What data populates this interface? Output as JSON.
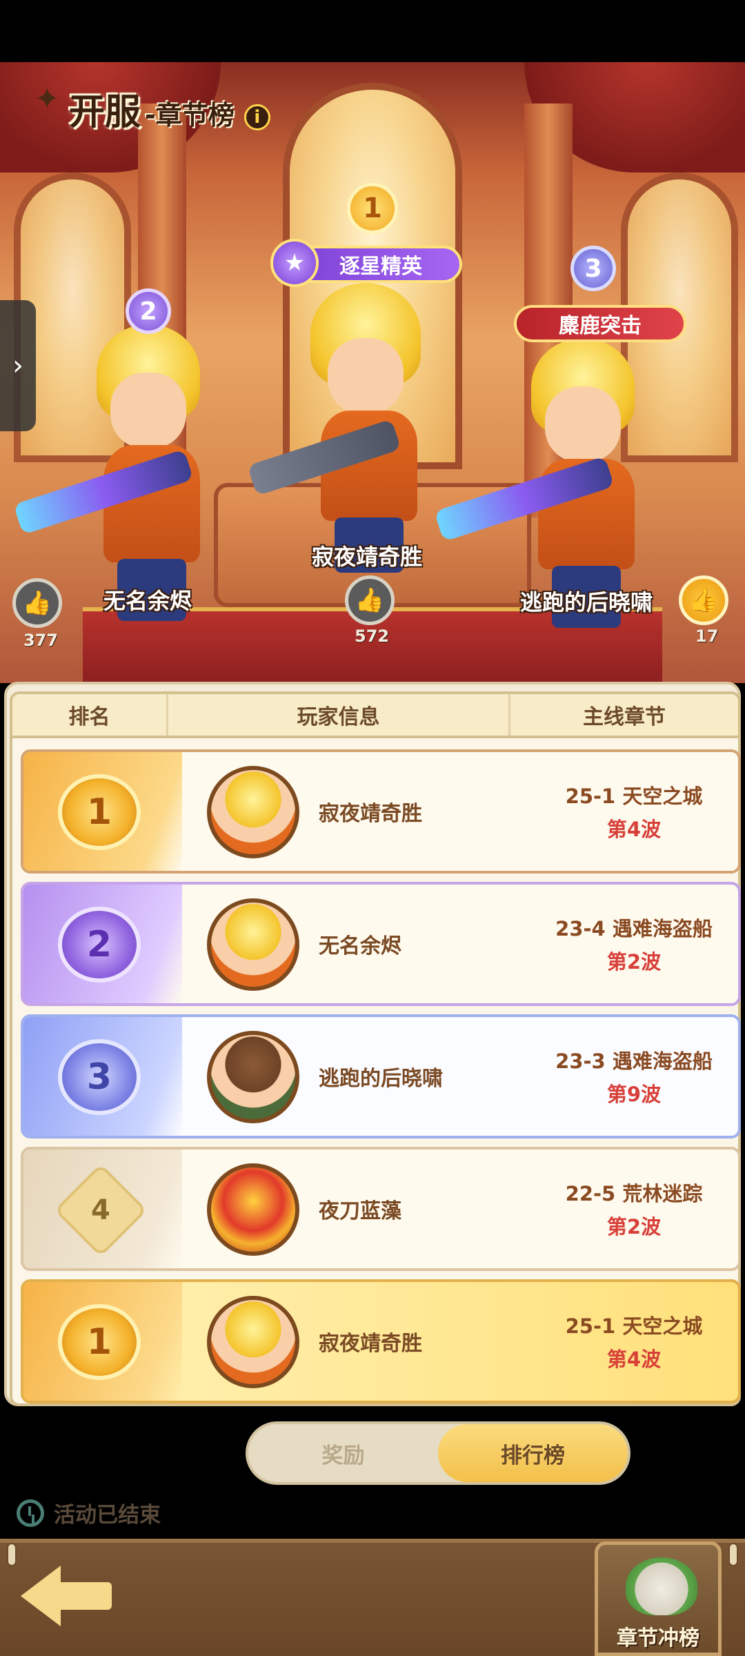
{
  "header": {
    "title_main": "开服",
    "title_sub": "-章节榜",
    "info_icon": "i"
  },
  "podium": {
    "first": {
      "rank": "1",
      "title_badge": "逐星精英",
      "name": "寂夜靖奇胜",
      "likes": "572"
    },
    "second": {
      "rank": "2",
      "name": "无名余烬",
      "likes": "377"
    },
    "third": {
      "rank": "3",
      "title_badge": "麋鹿突击",
      "name": "逃跑的后晓啸",
      "likes": "17"
    }
  },
  "table": {
    "headers": [
      "排名",
      "玩家信息",
      "主线章节"
    ],
    "rows": [
      {
        "rank": "1",
        "name": "寂夜靖奇胜",
        "stage": "25-1 天空之城",
        "wave": "第4波"
      },
      {
        "rank": "2",
        "name": "无名余烬",
        "stage": "23-4 遇难海盗船",
        "wave": "第2波"
      },
      {
        "rank": "3",
        "name": "逃跑的后晓啸",
        "stage": "23-3 遇难海盗船",
        "wave": "第9波"
      },
      {
        "rank": "4",
        "name": "夜刀蓝藻",
        "stage": "22-5 荒林迷踪",
        "wave": "第2波"
      }
    ],
    "my_row": {
      "rank": "1",
      "name": "寂夜靖奇胜",
      "stage": "25-1 天空之城",
      "wave": "第4波"
    }
  },
  "tabs": {
    "reward": "奖励",
    "ranking": "排行榜",
    "active": "ranking"
  },
  "status": {
    "ended": "活动已结束"
  },
  "bottom": {
    "chapter_button": "章节冲榜"
  },
  "icons": {
    "side_tab": "chevron-right-icon",
    "like": "thumbs-up-icon",
    "clock": "clock-icon",
    "back": "back-arrow-icon"
  },
  "colors": {
    "gold": "#f4b22c",
    "purple": "#9266e0",
    "blue": "#7f86e6",
    "wave_red": "#d8403a",
    "text_brown": "#7a4a24"
  }
}
